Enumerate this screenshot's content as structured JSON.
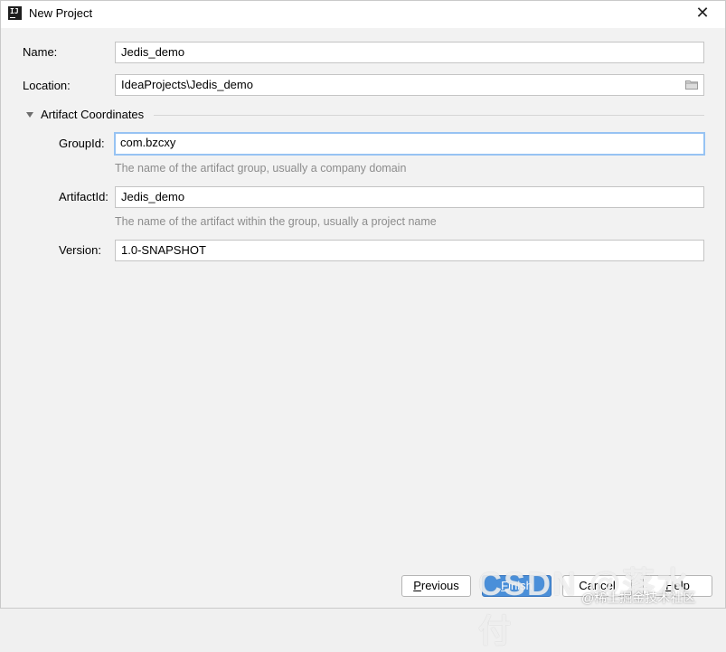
{
  "window": {
    "title": "New Project",
    "app_icon_text": "IJ",
    "close_glyph": "✕"
  },
  "form": {
    "name": {
      "label": "Name:",
      "value": "Jedis_demo"
    },
    "location": {
      "label": "Location:",
      "value": "IdeaProjects\\Jedis_demo",
      "icon": "folder-icon"
    }
  },
  "artifact": {
    "section_title": "Artifact Coordinates",
    "expanded": true,
    "group_id": {
      "label": "GroupId:",
      "value": "com.bzcxy",
      "hint": "The name of the artifact group, usually a company domain"
    },
    "artifact_id": {
      "label": "ArtifactId:",
      "value": "Jedis_demo",
      "hint": "The name of the artifact within the group, usually a project name"
    },
    "version": {
      "label": "Version:",
      "value": "1.0-SNAPSHOT"
    }
  },
  "buttons": {
    "previous": {
      "mnemonic": "P",
      "rest": "revious"
    },
    "finish": {
      "mnemonic": "F",
      "rest": "inish"
    },
    "cancel": "Cancel",
    "help": {
      "mnemonic": "H",
      "rest": "elp"
    }
  },
  "watermark": {
    "big": "CSDN @落水付",
    "small": "@稀土掘金技术社区"
  },
  "colors": {
    "focus_border": "#97c3f3",
    "primary_button": "#4a8fd9",
    "hint_text": "#8c8c8c"
  }
}
